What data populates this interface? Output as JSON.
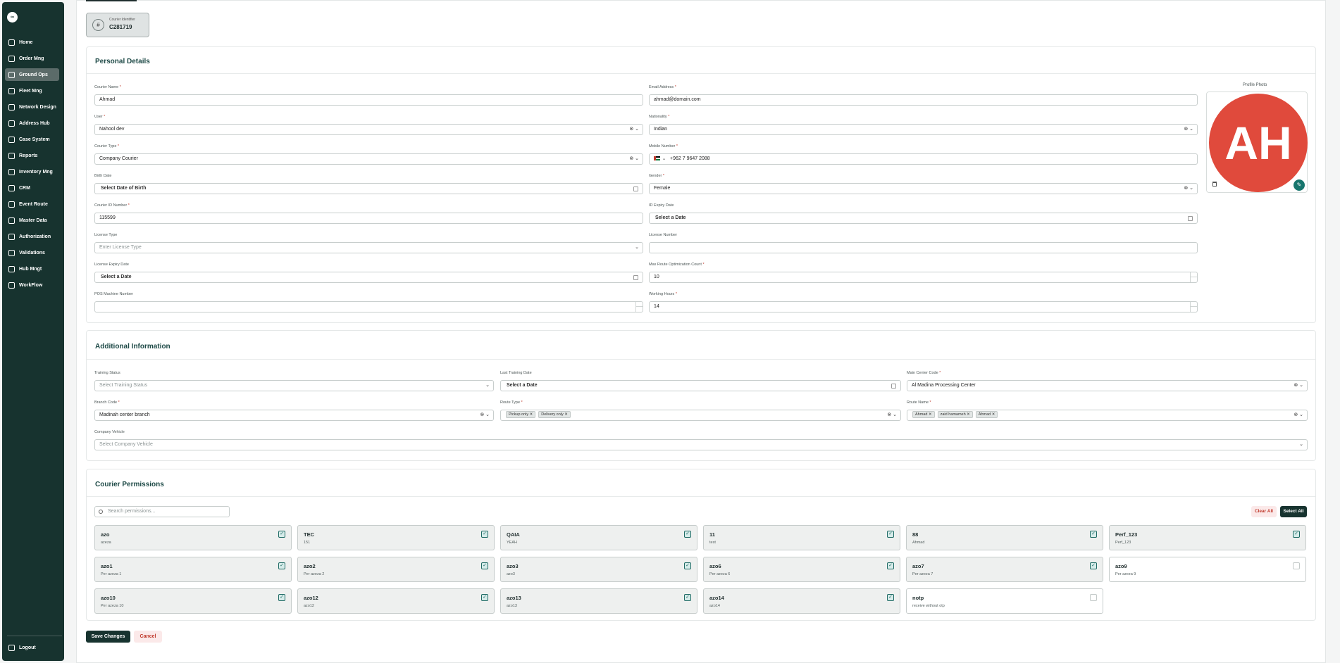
{
  "sidebar": {
    "logo": "∞",
    "items": [
      {
        "label": "Home",
        "icon": "home-icon"
      },
      {
        "label": "Order Mng",
        "icon": "order-icon"
      },
      {
        "label": "Ground Ops",
        "icon": "ground-ops-icon",
        "active": true
      },
      {
        "label": "Fleet Mng",
        "icon": "fleet-icon"
      },
      {
        "label": "Network Design",
        "icon": "network-icon"
      },
      {
        "label": "Address Hub",
        "icon": "address-icon"
      },
      {
        "label": "Case System",
        "icon": "case-icon"
      },
      {
        "label": "Reports",
        "icon": "reports-icon"
      },
      {
        "label": "Inventory Mng",
        "icon": "inventory-icon"
      },
      {
        "label": "CRM",
        "icon": "crm-icon"
      },
      {
        "label": "Event Route",
        "icon": "event-icon"
      },
      {
        "label": "Master Data",
        "icon": "master-data-icon"
      },
      {
        "label": "Authorization",
        "icon": "authorization-icon"
      },
      {
        "label": "Validations",
        "icon": "validations-icon"
      },
      {
        "label": "Hub Mngt",
        "icon": "hub-icon"
      },
      {
        "label": "WorkFlow",
        "icon": "workflow-icon"
      }
    ],
    "logout": "Logout"
  },
  "courier_identifier": {
    "label": "Courier Identifier",
    "value": "C281719"
  },
  "personal": {
    "title": "Personal Details",
    "photo_label": "Profile Photo",
    "avatar_initials": "AH",
    "courier_name": {
      "label": "Courier Name",
      "value": "Ahmad"
    },
    "email": {
      "label": "Email Address",
      "value": "ahmad@domain.com"
    },
    "user": {
      "label": "User",
      "value": "Nahool dev"
    },
    "nationality": {
      "label": "Nationality",
      "value": "Indian"
    },
    "courier_type": {
      "label": "Courier Type",
      "value": "Company Courier"
    },
    "mobile": {
      "label": "Mobile Number",
      "value": "+962 7 9647 2088"
    },
    "birth_date": {
      "label": "Birth Date",
      "value": "Select Date of Birth"
    },
    "gender": {
      "label": "Gender",
      "value": "Female"
    },
    "courier_id": {
      "label": "Courier ID Number",
      "value": "115599"
    },
    "id_expiry": {
      "label": "ID Expiry Date",
      "value": "Select a Date"
    },
    "license_type": {
      "label": "License Type",
      "placeholder": "Enter License Type"
    },
    "license_number": {
      "label": "License Number",
      "value": ""
    },
    "license_expiry": {
      "label": "License Expiry Date",
      "value": "Select a Date"
    },
    "max_route": {
      "label": "Max Route Optimization Count",
      "value": "10"
    },
    "pos_number": {
      "label": "POS Machine Number",
      "value": ""
    },
    "working_hours": {
      "label": "Working Hours",
      "value": "14"
    }
  },
  "additional": {
    "title": "Additional Information",
    "training_status": {
      "label": "Training Status",
      "placeholder": "Select Training Status"
    },
    "last_training": {
      "label": "Last Training Date",
      "value": "Select a Date"
    },
    "main_center": {
      "label": "Main Center Code",
      "value": "Al Madina Processing Center"
    },
    "branch_code": {
      "label": "Branch Code",
      "value": "Madinah center branch"
    },
    "route_type": {
      "label": "Route Type",
      "chips": [
        "Pickup only",
        "Delivery only"
      ]
    },
    "route_name": {
      "label": "Route Name",
      "chips": [
        "Ahmad",
        "zaid hamameh",
        "Ahmad"
      ]
    },
    "company_vehicle": {
      "label": "Company Vehicle",
      "placeholder": "Select Company Vehicle"
    }
  },
  "permissions": {
    "title": "Courier Permissions",
    "search_placeholder": "Search permissions...",
    "clear_all": "Clear All",
    "select_all": "Select All",
    "check_mark": "✓",
    "items": [
      {
        "name": "azo",
        "desc": "azeza",
        "checked": true
      },
      {
        "name": "TEC",
        "desc": "151",
        "checked": true
      },
      {
        "name": "QAIA",
        "desc": "YEAH",
        "checked": true
      },
      {
        "name": "11",
        "desc": "test",
        "checked": true
      },
      {
        "name": "88",
        "desc": "Ahmad",
        "checked": true
      },
      {
        "name": "Perf_123",
        "desc": "Perf_123",
        "checked": true
      },
      {
        "name": "azo1",
        "desc": "Per azeza 1",
        "checked": true
      },
      {
        "name": "azo2",
        "desc": "Per azeza 2",
        "checked": true
      },
      {
        "name": "azo3",
        "desc": "azo3",
        "checked": true
      },
      {
        "name": "azo6",
        "desc": "Per azeza 6",
        "checked": true
      },
      {
        "name": "azo7",
        "desc": "Per azeza 7",
        "checked": true
      },
      {
        "name": "azo9",
        "desc": "Per azeza 9",
        "checked": false
      },
      {
        "name": "azo10",
        "desc": "Per azeza 10",
        "checked": true
      },
      {
        "name": "azo12",
        "desc": "azo12",
        "checked": true
      },
      {
        "name": "azo13",
        "desc": "azo13",
        "checked": true
      },
      {
        "name": "azo14",
        "desc": "azo14",
        "checked": true
      },
      {
        "name": "notp",
        "desc": "receive without otp",
        "checked": false
      }
    ]
  },
  "actions": {
    "save": "Save Changes",
    "cancel": "Cancel"
  },
  "colors": {
    "sidebar": "#17332f",
    "active_nav": "#5b6b69",
    "avatar": "#e04a3c",
    "danger": "#c0392b",
    "accent": "#17766e"
  }
}
